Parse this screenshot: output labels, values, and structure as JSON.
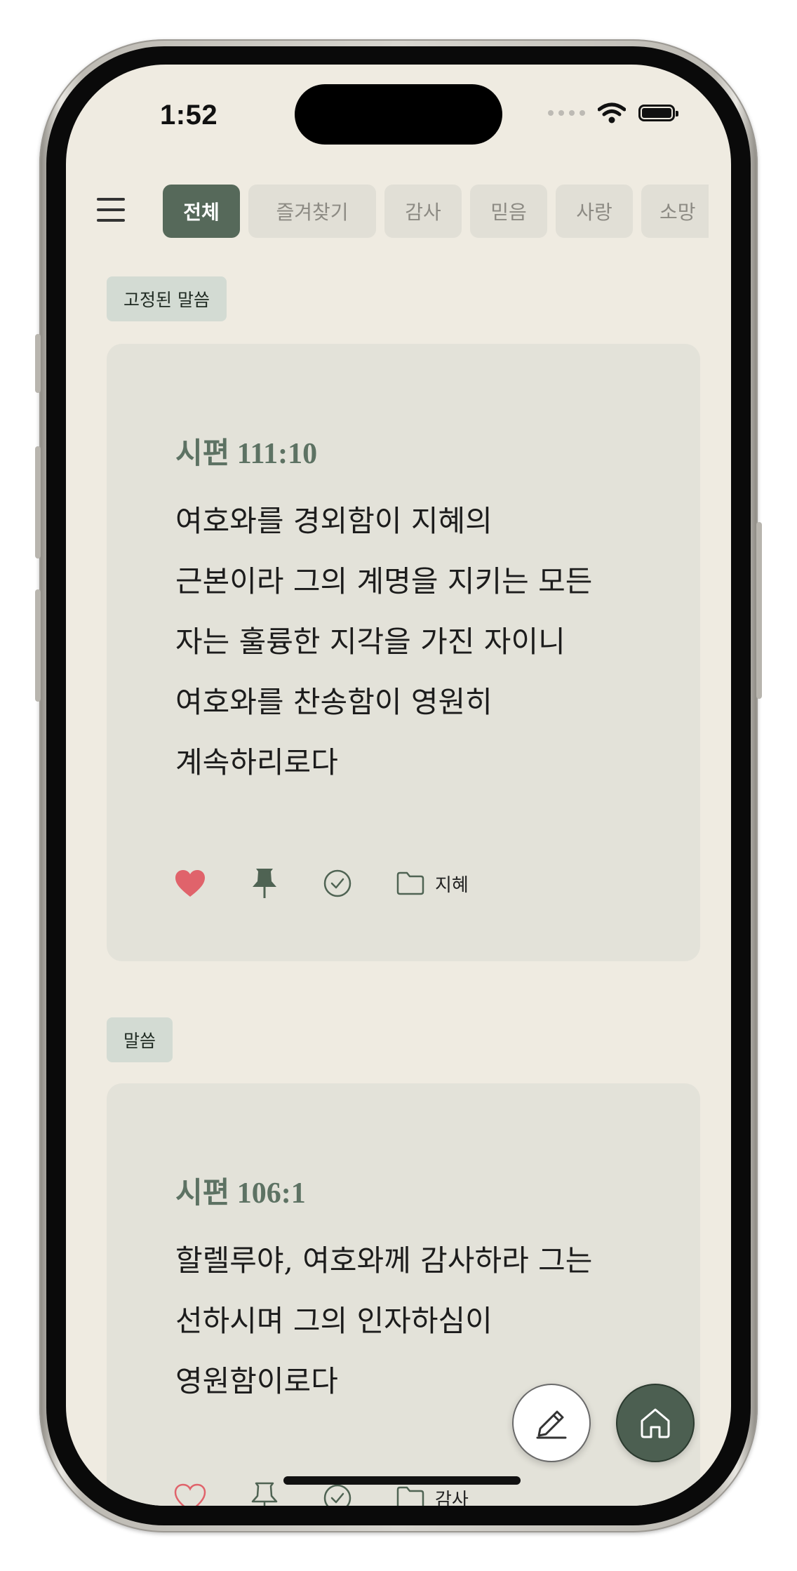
{
  "status_bar": {
    "time": "1:52"
  },
  "tabs": [
    {
      "label": "전체",
      "active": true
    },
    {
      "label": "즐겨찾기",
      "active": false
    },
    {
      "label": "감사",
      "active": false
    },
    {
      "label": "믿음",
      "active": false
    },
    {
      "label": "사랑",
      "active": false
    },
    {
      "label": "소망",
      "active": false
    }
  ],
  "pinned_section": {
    "badge": "고정된 말씀",
    "card": {
      "reference": "시편 111:10",
      "lines": [
        "여호와를 경외함이 지혜의",
        "근본이라 그의 계명을 지키는 모든",
        "자는 훌륭한 지각을 가진 자이니",
        "여호와를 찬송함이 영원히",
        "계속하리로다"
      ],
      "favorite": true,
      "pinned": true,
      "category": "지혜"
    }
  },
  "verses_section": {
    "badge": "말씀",
    "card": {
      "reference": "시편 106:1",
      "lines": [
        "할렐루야, 여호와께 감사하라 그는",
        "선하시며 그의 인자하심이",
        "영원함이로다"
      ],
      "favorite": false,
      "pinned": false,
      "category": "감사"
    }
  },
  "colors": {
    "accent": "#56695a",
    "background": "#efebe1",
    "card": "#e3e2d9",
    "heart": "#e0636b"
  },
  "icons": {
    "menu": "hamburger-menu-icon",
    "favorite": "heart-icon",
    "pin": "pin-icon",
    "check": "check-circle-icon",
    "folder": "folder-icon",
    "edit": "pencil-icon",
    "home": "home-icon"
  }
}
